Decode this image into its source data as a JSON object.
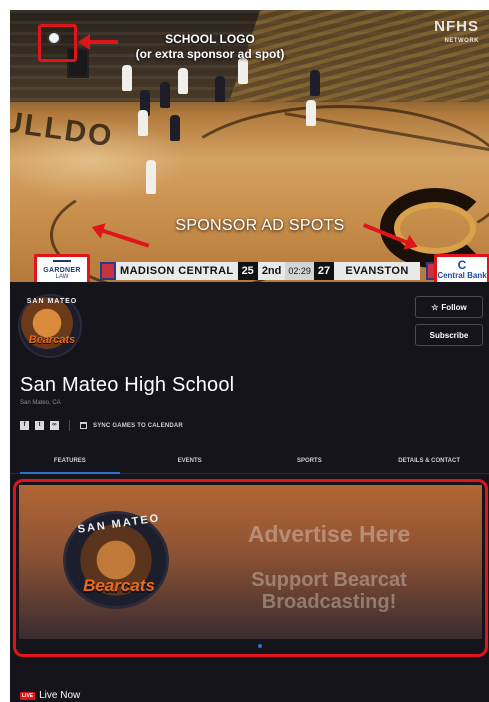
{
  "annotations": {
    "school_logo_callout": "SCHOOL LOGO",
    "school_logo_sub": "(or extra sponsor ad spot)",
    "sponsor_callout": "SPONSOR AD SPOTS"
  },
  "broadcast": {
    "network": "NFHS",
    "network_sub": "NETWORK",
    "court_text": "ULLDO",
    "home_team": "MADISON CENTRAL",
    "home_score": "25",
    "period": "2nd",
    "clock": "02:29",
    "away_score": "27",
    "away_team": "EVANSTON",
    "sponsor_left_line1": "GARDNER",
    "sponsor_left_line2": "LAW",
    "sponsor_right_icon": "C",
    "sponsor_right_name": "Central Bank"
  },
  "profile": {
    "logo_arc": "SAN MATEO",
    "logo_script": "Bearcats",
    "follow_label": "Follow",
    "follow_icon": "☆",
    "subscribe_label": "Subscribe",
    "school_name": "San Mateo High School",
    "location": "San Mateo, CA",
    "sync_label": "SYNC GAMES TO CALENDAR",
    "social_icons": [
      "facebook-icon",
      "twitter-icon",
      "link-icon"
    ]
  },
  "tabs": [
    "FEATURES",
    "EVENTS",
    "SPORTS",
    "DETAILS & CONTACT"
  ],
  "banner": {
    "logo_arc": "SAN MATEO",
    "logo_script": "Bearcats",
    "title": "Advertise Here",
    "subtitle_line1": "Support Bearcat",
    "subtitle_line2": "Broadcasting!"
  },
  "live": {
    "badge": "LIVE",
    "label": "Live Now"
  },
  "colors": {
    "annotation_red": "#e0151b",
    "dark_bg": "#15141b",
    "tab_accent": "#2f6fd0"
  }
}
